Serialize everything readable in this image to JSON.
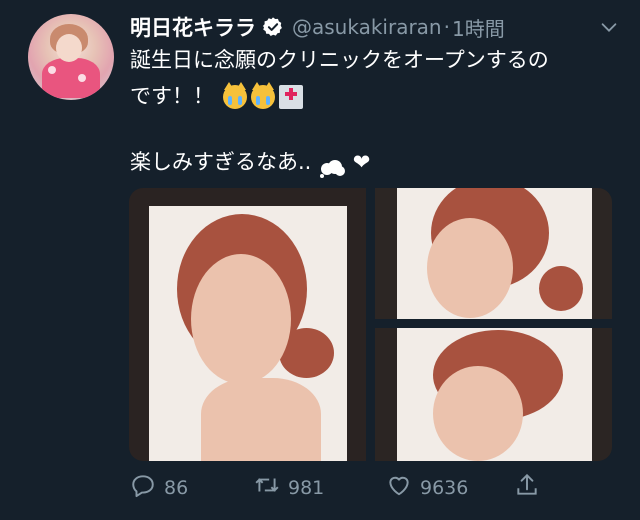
{
  "tweet": {
    "display_name": "明日花キララ",
    "handle": "@asukakiraran",
    "separator": "·",
    "time": "1時間",
    "text_line1": "誕生日に念願のクリニックをオープンするの",
    "text_line2_prefix": "です！！",
    "text_line3": "楽しみすぎるなあ..",
    "heart": "❤",
    "emojis": [
      "crying-cat-emoji",
      "crying-cat-emoji",
      "hospital-emoji",
      "thought-balloon-emoji"
    ]
  },
  "actions": {
    "reply_count": "86",
    "retweet_count": "981",
    "like_count": "9636"
  },
  "colors": {
    "background": "#15202b",
    "secondary_text": "#8899a6",
    "verified_badge": "#ffffff"
  }
}
